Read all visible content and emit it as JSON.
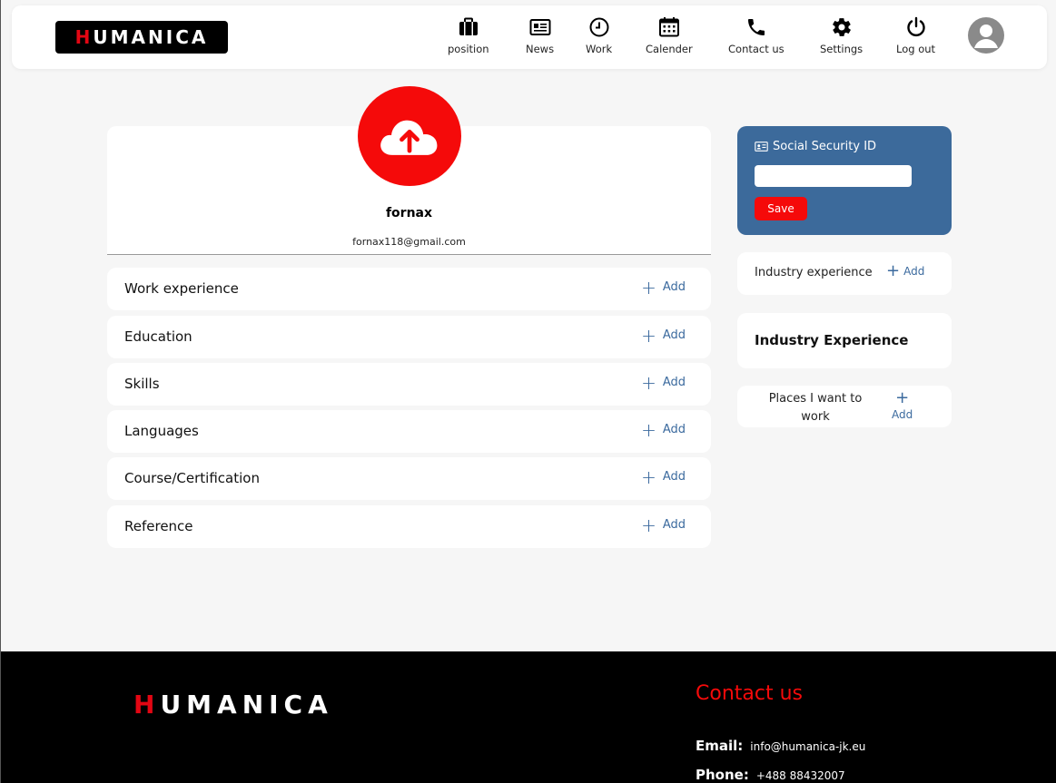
{
  "header": {
    "logo": {
      "first": "H",
      "rest": "UMANICA"
    },
    "nav": [
      {
        "label": "position",
        "icon": "briefcase-icon"
      },
      {
        "label": "News",
        "icon": "newspaper-icon"
      },
      {
        "label": "Work",
        "icon": "clock-icon"
      },
      {
        "label": "Calender",
        "icon": "calendar-icon"
      },
      {
        "label": "Contact us",
        "icon": "phone-icon"
      },
      {
        "label": "Settings",
        "icon": "gear-icon"
      },
      {
        "label": "Log out",
        "icon": "power-icon"
      }
    ],
    "avatar_icon": "user-avatar-icon"
  },
  "profile": {
    "upload_icon": "cloud-upload-icon",
    "name": "fornax",
    "email": "fornax118@gmail.com"
  },
  "sections": [
    {
      "title": "Work experience",
      "add_label": "Add"
    },
    {
      "title": "Education",
      "add_label": "Add"
    },
    {
      "title": "Skills",
      "add_label": "Add"
    },
    {
      "title": "Languages",
      "add_label": "Add"
    },
    {
      "title": "Course/Certification",
      "add_label": "Add"
    },
    {
      "title": "Reference",
      "add_label": "Add"
    }
  ],
  "ssid": {
    "title": "Social Security ID",
    "input_value": "",
    "save_label": "Save"
  },
  "industry": {
    "label": "Industry experience",
    "add_label": "Add",
    "heading": "Industry Experience"
  },
  "places": {
    "label": "Places I want to work",
    "add_label": "Add"
  },
  "footer": {
    "logo": {
      "first": "H",
      "rest": "UMANICA"
    },
    "contact_title": "Contact us",
    "email_label": "Email:",
    "email_value": "info@humanica-jk.eu",
    "phone_label": "Phone:",
    "phone_value": "+488 88432007"
  },
  "colors": {
    "brand_red": "#f50a0a",
    "accent_blue": "#3c6a9b",
    "link_blue": "#3b6a9e"
  }
}
